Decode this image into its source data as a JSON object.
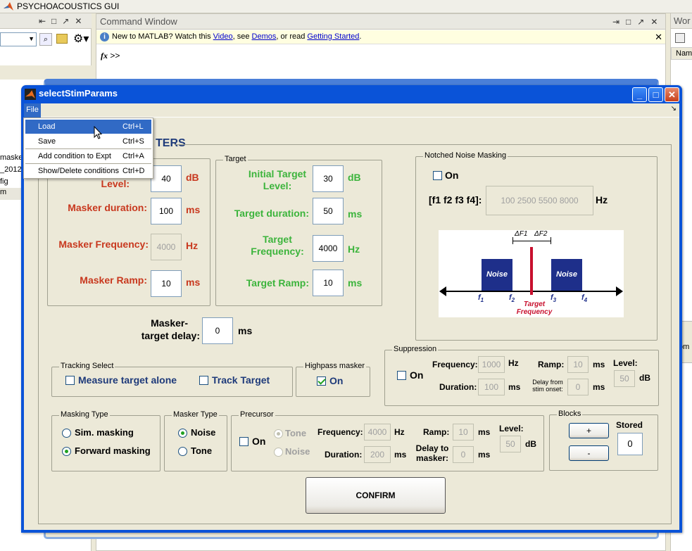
{
  "matlab": {
    "title": "PSYCHOACOUSTICS GUI",
    "command_window": {
      "title": "Command Window",
      "info_prefix": "New to MATLAB? Watch this",
      "link_video": "Video",
      "info_mid1": ", see",
      "link_demos": "Demos",
      "info_mid2": ", or read",
      "link_getting_started": "Getting Started",
      "info_end": ".",
      "fx": "fx",
      "prompt": ">>"
    },
    "workspace_title": "Wor",
    "workspace_col": "Nam",
    "left_items": [
      "maske",
      "_2012",
      "fig",
      "m"
    ],
    "right_cut_label": "om"
  },
  "dialog": {
    "title": "selectStimParams",
    "menu_file": "File",
    "header_partial": "TERS",
    "file_menu": [
      {
        "label": "Load",
        "shortcut": "Ctrl+L"
      },
      {
        "label": "Save",
        "shortcut": "Ctrl+S"
      },
      {
        "label": "Add condition to Expt",
        "shortcut": "Ctrl+A"
      },
      {
        "label": "Show/Delete conditions",
        "shortcut": "Ctrl+D"
      }
    ],
    "masker": {
      "level_label": "Level:",
      "level_value": "40",
      "level_unit": "dB",
      "duration_label": "Masker duration:",
      "duration_value": "100",
      "duration_unit": "ms",
      "frequency_label": "Masker Frequency:",
      "frequency_value": "4000",
      "frequency_unit": "Hz",
      "ramp_label": "Masker Ramp:",
      "ramp_value": "10",
      "ramp_unit": "ms"
    },
    "target": {
      "group_label": "Target",
      "initial_level_label": "Initial Target Level:",
      "initial_level_value": "30",
      "initial_level_unit": "dB",
      "duration_label": "Target duration:",
      "duration_value": "50",
      "duration_unit": "ms",
      "frequency_label": "Target Frequency:",
      "frequency_value": "4000",
      "frequency_unit": "Hz",
      "ramp_label": "Target Ramp:",
      "ramp_value": "10",
      "ramp_unit": "ms"
    },
    "notched_noise": {
      "group_label": "Notched Noise Masking",
      "on_label": "On",
      "on_checked": false,
      "f_label": "[f1 f2 f3 f4]:",
      "f_value": "100  2500  5500  8000",
      "f_unit": "Hz",
      "diagram": {
        "noise1": "Noise",
        "noise2": "Noise",
        "df1": "ΔF1",
        "df2": "ΔF2",
        "f1": "f",
        "f2": "f",
        "f3": "f",
        "f4": "f",
        "f1_sub": "1",
        "f2_sub": "2",
        "f3_sub": "3",
        "f4_sub": "4",
        "target_line1": "Target",
        "target_line2": "Frequency"
      }
    },
    "masker_target_delay": {
      "label_line1": "Masker-",
      "label_line2": "target delay:",
      "value": "0",
      "unit": "ms"
    },
    "suppression": {
      "group_label": "Suppression",
      "on_label": "On",
      "on_checked": false,
      "frequency_label": "Frequency:",
      "frequency_value": "1000",
      "frequency_unit": "Hz",
      "duration_label": "Duration:",
      "duration_value": "100",
      "duration_unit": "ms",
      "ramp_label": "Ramp:",
      "ramp_value": "10",
      "ramp_unit": "ms",
      "delay_label_line1": "Delay from",
      "delay_label_line2": "stim onset:",
      "delay_value": "0",
      "delay_unit": "ms",
      "level_label": "Level:",
      "level_value": "50",
      "level_unit": "dB"
    },
    "tracking": {
      "group_label": "Tracking Select",
      "measure_label": "Measure target alone",
      "measure_checked": false,
      "track_label": "Track Target",
      "track_checked": false
    },
    "highpass": {
      "group_label": "Highpass masker",
      "on_label": "On",
      "on_checked": true
    },
    "masking_type": {
      "group_label": "Masking Type",
      "sim_label": "Sim. masking",
      "forward_label": "Forward masking",
      "selected": "forward"
    },
    "masker_type": {
      "group_label": "Masker Type",
      "noise_label": "Noise",
      "tone_label": "Tone",
      "selected": "noise"
    },
    "precursor": {
      "group_label": "Precursor",
      "on_label": "On",
      "on_checked": false,
      "tone_label": "Tone",
      "noise_label": "Noise",
      "frequency_label": "Frequency:",
      "frequency_value": "4000",
      "frequency_unit": "Hz",
      "duration_label": "Duration:",
      "duration_value": "200",
      "duration_unit": "ms",
      "ramp_label": "Ramp:",
      "ramp_value": "10",
      "ramp_unit": "ms",
      "delay_label_line1": "Delay to",
      "delay_label_line2": "masker:",
      "delay_value": "0",
      "delay_unit": "ms",
      "level_label": "Level:",
      "level_value": "50",
      "level_unit": "dB"
    },
    "blocks": {
      "group_label": "Blocks",
      "plus_label": "+",
      "minus_label": "-",
      "stored_label": "Stored",
      "stored_value": "0"
    },
    "confirm_label": "CONFIRM"
  },
  "colors": {
    "masker_red": "#c8381e",
    "target_green": "#3cb43c",
    "title_blue": "#0a53d8",
    "noise_block": "#1e2f8a",
    "target_line": "#c8102e"
  }
}
